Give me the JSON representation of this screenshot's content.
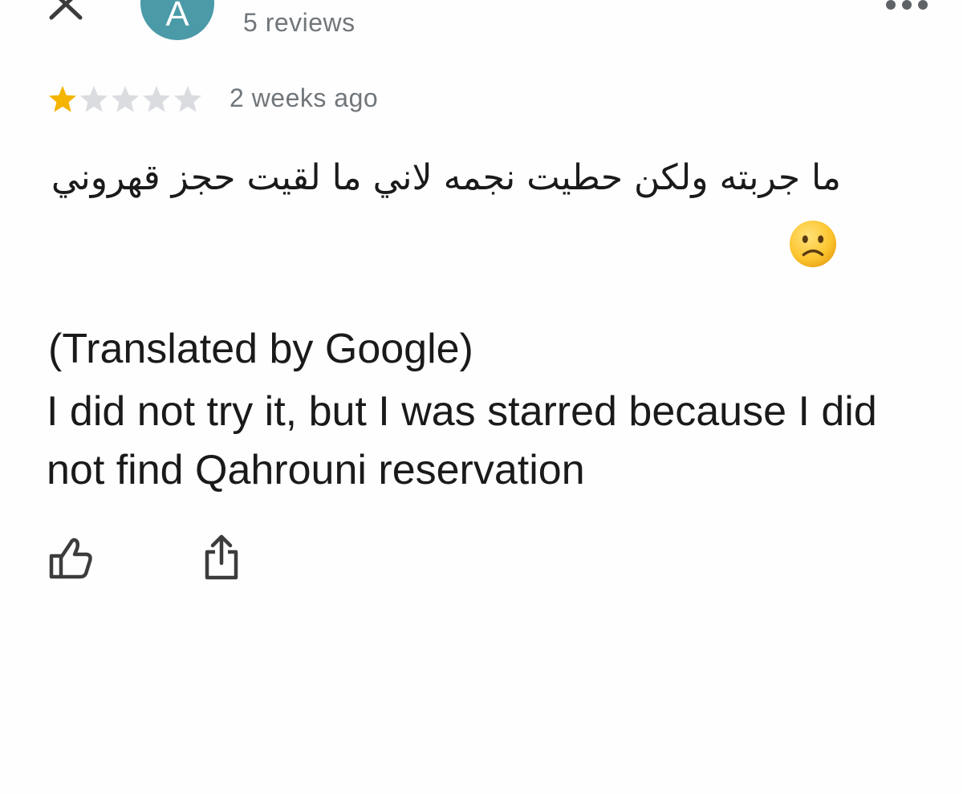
{
  "header": {
    "close_icon": "close-icon",
    "avatar_initial": "A",
    "avatar_color": "#4a9aa8",
    "review_count": "5 reviews",
    "more_icon": "more-horizontal-icon"
  },
  "review": {
    "rating": 1,
    "rating_max": 5,
    "star_filled_color": "#f4b400",
    "star_empty_color": "#dadce0",
    "date": "2 weeks ago",
    "original_text": "ما جربته ولكن حطيت نجمه لاني ما لقيت حجز قهروني",
    "original_emoji": "slightly-frowning-face-icon",
    "translated_label": "(Translated by Google)",
    "translated_text": "I did not try it, but I was starred because I did not find Qahrouni reservation"
  },
  "actions": {
    "like_icon": "thumbs-up-icon",
    "share_icon": "share-icon"
  }
}
